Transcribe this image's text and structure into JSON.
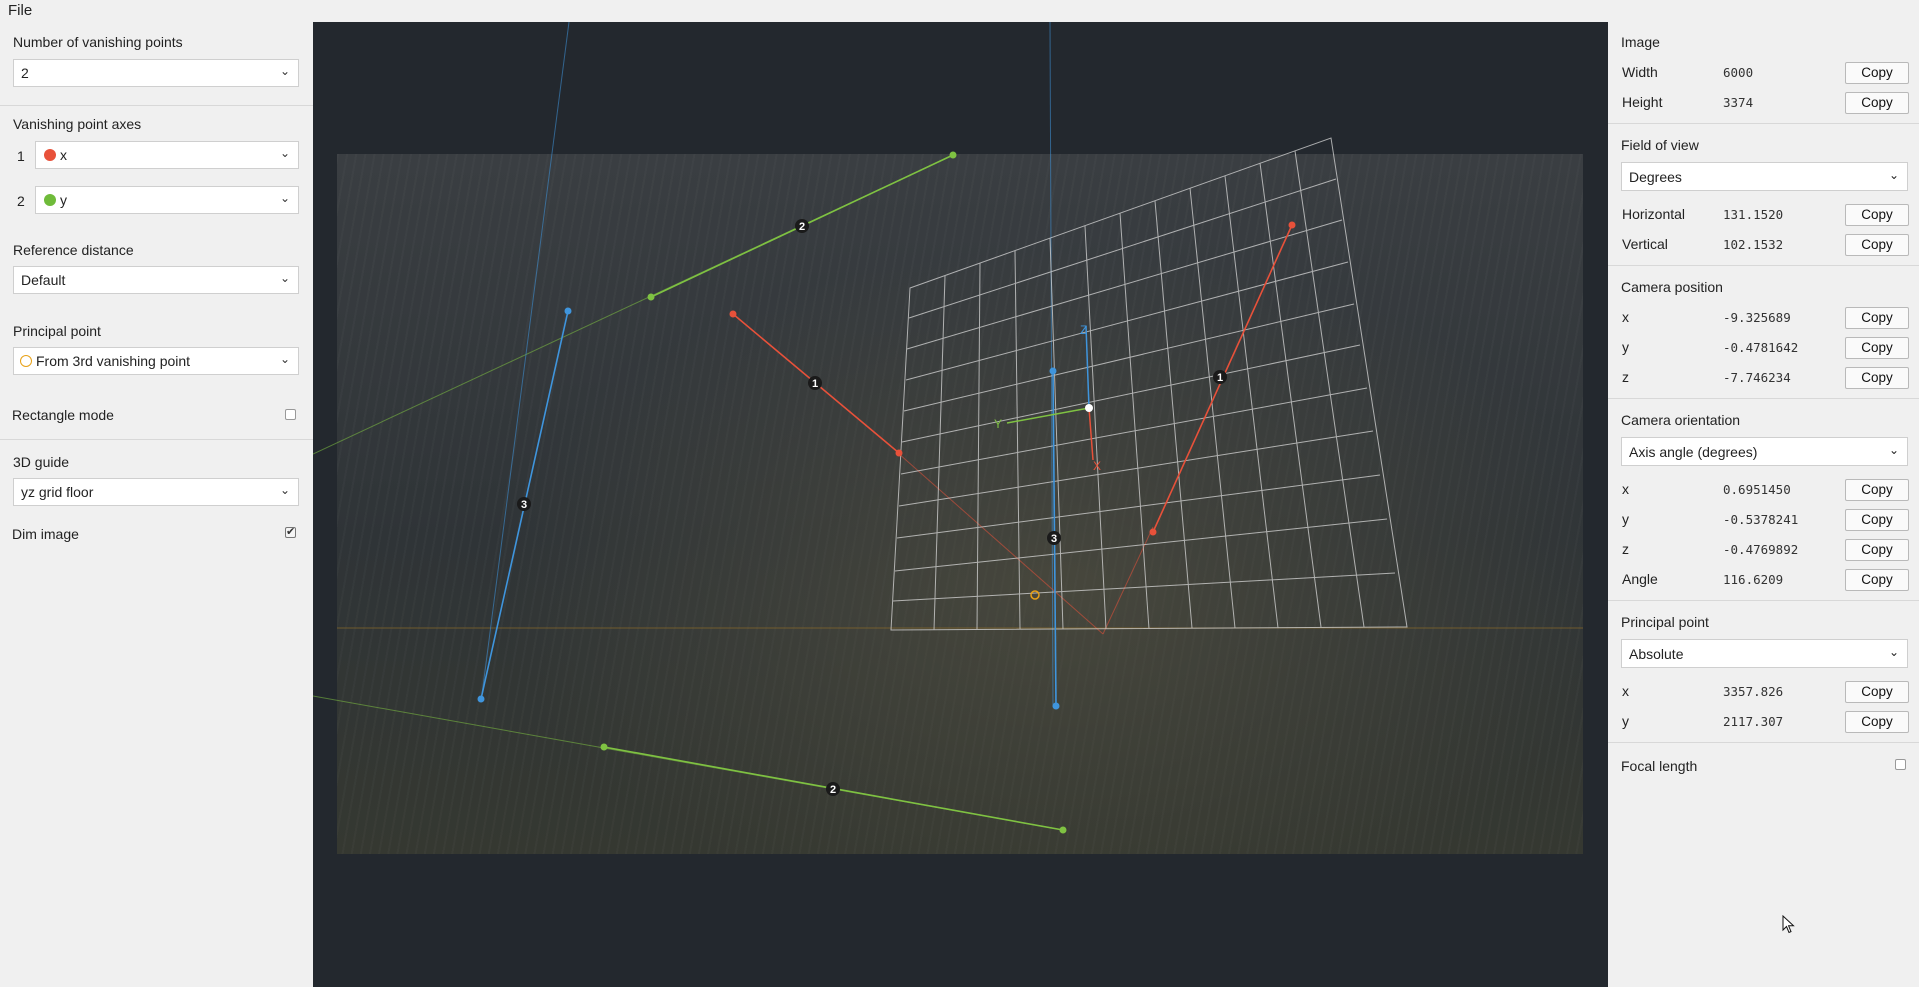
{
  "menu": {
    "file": "File"
  },
  "left": {
    "num_vp_label": "Number of vanishing points",
    "num_vp_value": "2",
    "axes_label": "Vanishing point axes",
    "axes": [
      {
        "index": "1",
        "color": "#e8513a",
        "value": "x"
      },
      {
        "index": "2",
        "color": "#6fbb3a",
        "value": "y"
      }
    ],
    "ref_label": "Reference distance",
    "ref_value": "Default",
    "pp_label": "Principal point",
    "pp_value": "From 3rd vanishing point",
    "rect_label": "Rectangle mode",
    "rect_checked": false,
    "guide_label": "3D guide",
    "guide_value": "yz grid floor",
    "dim_label": "Dim image",
    "dim_checked": true
  },
  "canvas": {
    "line_labels": {
      "red": "1",
      "green": "2",
      "blue": "3"
    },
    "axis_labels": {
      "x": "X",
      "y": "Y",
      "z": "Z"
    },
    "colors": {
      "red": "#e8513a",
      "green": "#7fc242",
      "blue": "#3f95dd",
      "orange": "#e8a117"
    }
  },
  "right": {
    "image_label": "Image",
    "width_label": "Width",
    "width_value": "6000",
    "height_label": "Height",
    "height_value": "3374",
    "fov_label": "Field of view",
    "fov_unit": "Degrees",
    "horizontal_label": "Horizontal",
    "horizontal_value": "131.1520",
    "vertical_label": "Vertical",
    "vertical_value": "102.1532",
    "cam_pos_label": "Camera position",
    "cam_pos": [
      {
        "label": "x",
        "value": "-9.325689"
      },
      {
        "label": "y",
        "value": "-0.4781642"
      },
      {
        "label": "z",
        "value": "-7.746234"
      }
    ],
    "cam_orient_label": "Camera orientation",
    "cam_orient_mode": "Axis angle (degrees)",
    "cam_orient": [
      {
        "label": "x",
        "value": "0.6951450"
      },
      {
        "label": "y",
        "value": "-0.5378241"
      },
      {
        "label": "z",
        "value": "-0.4769892"
      },
      {
        "label": "Angle",
        "value": "116.6209"
      }
    ],
    "pp_label": "Principal point",
    "pp_mode": "Absolute",
    "pp": [
      {
        "label": "x",
        "value": "3357.826"
      },
      {
        "label": "y",
        "value": "2117.307"
      }
    ],
    "focal_label": "Focal length",
    "focal_checked": false,
    "copy_label": "Copy"
  }
}
